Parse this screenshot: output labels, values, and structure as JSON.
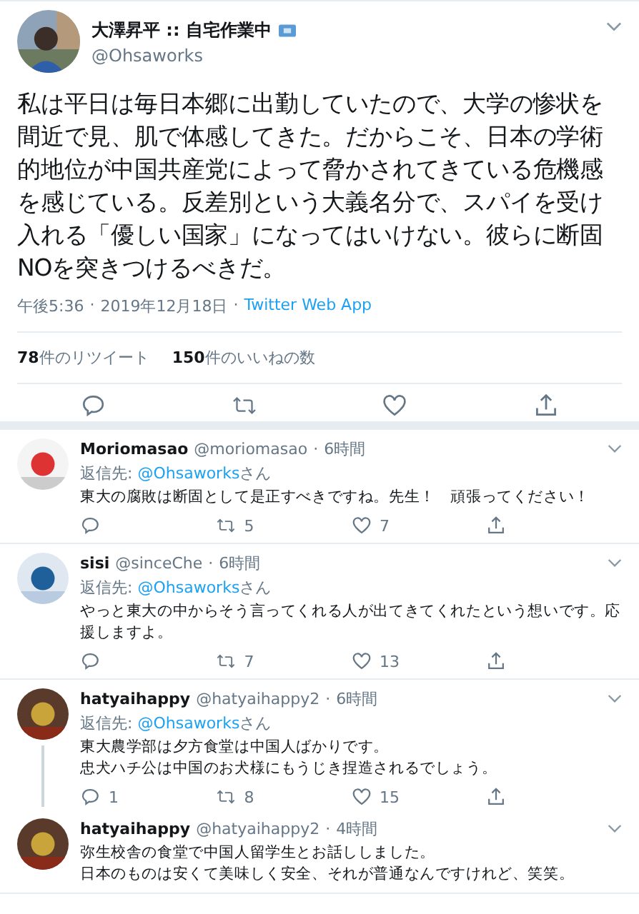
{
  "separator": "·",
  "tweet": {
    "author": {
      "name": "大澤昇平 :: 自宅作業中",
      "handle": "@Ohsaworks"
    },
    "text": "私は平日は毎日本郷に出勤していたので、大学の惨状を間近で見、肌で体感してきた。だからこそ、日本の学術的地位が中国共産党によって脅かされてきている危機感を感じている。反差別という大義名分で、スパイを受け入れる「優しい国家」になってはいけない。彼らに断固NOを突きつけるべきだ。",
    "time": "午後5:36",
    "date": "2019年12月18日",
    "source": "Twitter Web App",
    "stats": [
      {
        "count": "78",
        "label": "件のリツイート"
      },
      {
        "count": "150",
        "label": "件のいいねの数"
      }
    ]
  },
  "replies": [
    {
      "name": "Moriomasao",
      "handle": "@moriomasao",
      "time": "6時間",
      "reply_to": {
        "label": "返信先:",
        "mention": "@Ohsaworks",
        "suffix": "さん"
      },
      "text": "東大の腐敗は断固として是正すべきですね。先生！　頑張ってください！",
      "retweets": "5",
      "likes": "7",
      "threaded": false
    },
    {
      "name": "sisi",
      "handle": "@sinceChe",
      "time": "6時間",
      "reply_to": {
        "label": "返信先:",
        "mention": "@Ohsaworks",
        "suffix": "さん"
      },
      "text": "やっと東大の中からそう言ってくれる人が出てきてくれたという想いです。応援しますよ。",
      "retweets": "7",
      "likes": "13",
      "threaded": false
    },
    {
      "name": "hatyaihappy",
      "handle": "@hatyaihappy2",
      "time": "6時間",
      "reply_to": {
        "label": "返信先:",
        "mention": "@Ohsaworks",
        "suffix": "さん"
      },
      "lines": [
        "東大農学部は夕方食堂は中国人ばかりです。",
        "忠犬ハチ公は中国のお犬様にもうじき捏造されるでしょう。"
      ],
      "replies": "1",
      "retweets": "8",
      "likes": "15",
      "threaded": true
    },
    {
      "name": "hatyaihappy",
      "handle": "@hatyaihappy2",
      "time": "4時間",
      "lines": [
        "弥生校舎の食堂で中国人留学生とお話ししました。",
        "日本のものは安くて美味しく安全、それが普通なんですけれど、笑笑。"
      ],
      "threaded": false
    }
  ]
}
